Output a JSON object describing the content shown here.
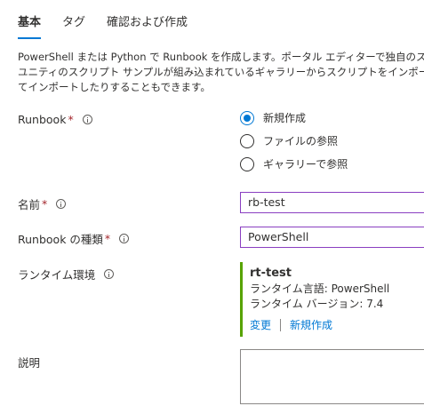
{
  "tabs": [
    {
      "label": "基本"
    },
    {
      "label": "タグ"
    },
    {
      "label": "確認および作成"
    }
  ],
  "description": {
    "line1": "PowerShell または Python で Runbook を作成します。ポータル エディターで独自のス",
    "line2": "ユニティのスクリプト サンプルが組み込まれているギャラリーからスクリプトをインポートしたり、ロー",
    "line3": "てインポートしたりすることもできます。"
  },
  "runbook_field": {
    "label": "Runbook",
    "required_mark": "*",
    "options": [
      {
        "label": "新規作成",
        "checked": true
      },
      {
        "label": "ファイルの参照",
        "checked": false
      },
      {
        "label": "ギャラリーで参照",
        "checked": false
      }
    ]
  },
  "name_field": {
    "label": "名前",
    "required_mark": "*",
    "value": "rb-test"
  },
  "type_field": {
    "label": "Runbook の種類",
    "required_mark": "*",
    "value": "PowerShell"
  },
  "runtime_field": {
    "label": "ランタイム環境",
    "name": "rt-test",
    "language": "ランタイム言語: PowerShell",
    "version": "ランタイム バージョン: 7.4",
    "change_link": "変更",
    "new_link": "新規作成"
  },
  "description_field": {
    "label": "説明",
    "value": ""
  },
  "colors": {
    "accent": "#0078d4",
    "runtime_bar": "#57a300",
    "focus_border": "#8a3fc1",
    "required": "#a4262c"
  }
}
